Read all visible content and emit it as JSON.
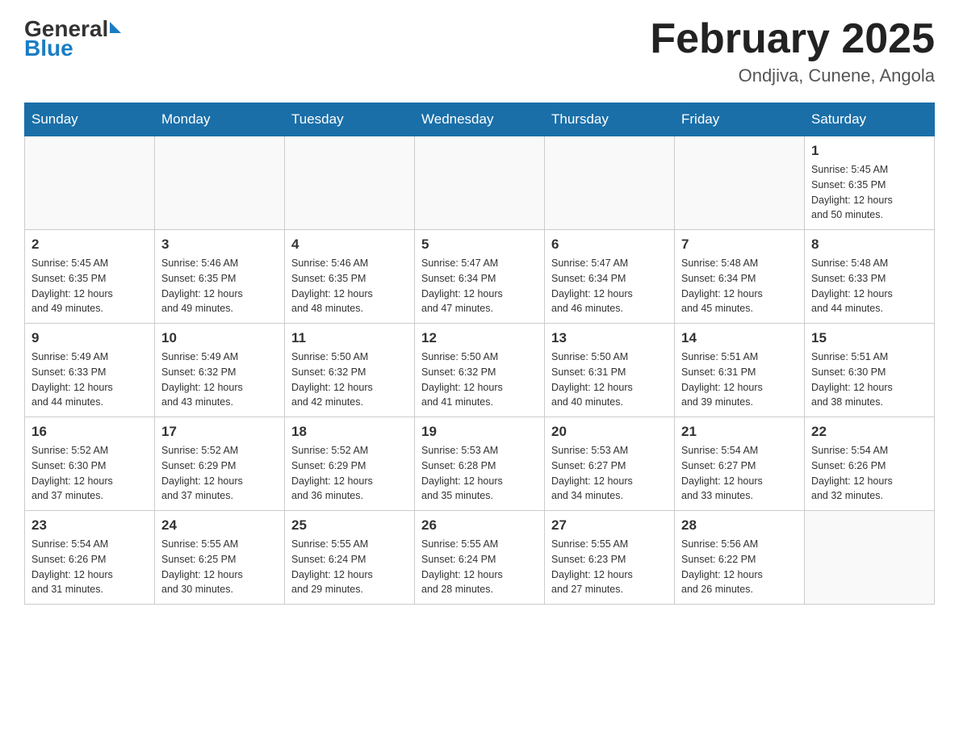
{
  "header": {
    "logo_general": "General",
    "logo_blue": "Blue",
    "title": "February 2025",
    "subtitle": "Ondjiva, Cunene, Angola"
  },
  "days_of_week": [
    "Sunday",
    "Monday",
    "Tuesday",
    "Wednesday",
    "Thursday",
    "Friday",
    "Saturday"
  ],
  "weeks": [
    [
      {
        "day": "",
        "info": ""
      },
      {
        "day": "",
        "info": ""
      },
      {
        "day": "",
        "info": ""
      },
      {
        "day": "",
        "info": ""
      },
      {
        "day": "",
        "info": ""
      },
      {
        "day": "",
        "info": ""
      },
      {
        "day": "1",
        "info": "Sunrise: 5:45 AM\nSunset: 6:35 PM\nDaylight: 12 hours\nand 50 minutes."
      }
    ],
    [
      {
        "day": "2",
        "info": "Sunrise: 5:45 AM\nSunset: 6:35 PM\nDaylight: 12 hours\nand 49 minutes."
      },
      {
        "day": "3",
        "info": "Sunrise: 5:46 AM\nSunset: 6:35 PM\nDaylight: 12 hours\nand 49 minutes."
      },
      {
        "day": "4",
        "info": "Sunrise: 5:46 AM\nSunset: 6:35 PM\nDaylight: 12 hours\nand 48 minutes."
      },
      {
        "day": "5",
        "info": "Sunrise: 5:47 AM\nSunset: 6:34 PM\nDaylight: 12 hours\nand 47 minutes."
      },
      {
        "day": "6",
        "info": "Sunrise: 5:47 AM\nSunset: 6:34 PM\nDaylight: 12 hours\nand 46 minutes."
      },
      {
        "day": "7",
        "info": "Sunrise: 5:48 AM\nSunset: 6:34 PM\nDaylight: 12 hours\nand 45 minutes."
      },
      {
        "day": "8",
        "info": "Sunrise: 5:48 AM\nSunset: 6:33 PM\nDaylight: 12 hours\nand 44 minutes."
      }
    ],
    [
      {
        "day": "9",
        "info": "Sunrise: 5:49 AM\nSunset: 6:33 PM\nDaylight: 12 hours\nand 44 minutes."
      },
      {
        "day": "10",
        "info": "Sunrise: 5:49 AM\nSunset: 6:32 PM\nDaylight: 12 hours\nand 43 minutes."
      },
      {
        "day": "11",
        "info": "Sunrise: 5:50 AM\nSunset: 6:32 PM\nDaylight: 12 hours\nand 42 minutes."
      },
      {
        "day": "12",
        "info": "Sunrise: 5:50 AM\nSunset: 6:32 PM\nDaylight: 12 hours\nand 41 minutes."
      },
      {
        "day": "13",
        "info": "Sunrise: 5:50 AM\nSunset: 6:31 PM\nDaylight: 12 hours\nand 40 minutes."
      },
      {
        "day": "14",
        "info": "Sunrise: 5:51 AM\nSunset: 6:31 PM\nDaylight: 12 hours\nand 39 minutes."
      },
      {
        "day": "15",
        "info": "Sunrise: 5:51 AM\nSunset: 6:30 PM\nDaylight: 12 hours\nand 38 minutes."
      }
    ],
    [
      {
        "day": "16",
        "info": "Sunrise: 5:52 AM\nSunset: 6:30 PM\nDaylight: 12 hours\nand 37 minutes."
      },
      {
        "day": "17",
        "info": "Sunrise: 5:52 AM\nSunset: 6:29 PM\nDaylight: 12 hours\nand 37 minutes."
      },
      {
        "day": "18",
        "info": "Sunrise: 5:52 AM\nSunset: 6:29 PM\nDaylight: 12 hours\nand 36 minutes."
      },
      {
        "day": "19",
        "info": "Sunrise: 5:53 AM\nSunset: 6:28 PM\nDaylight: 12 hours\nand 35 minutes."
      },
      {
        "day": "20",
        "info": "Sunrise: 5:53 AM\nSunset: 6:27 PM\nDaylight: 12 hours\nand 34 minutes."
      },
      {
        "day": "21",
        "info": "Sunrise: 5:54 AM\nSunset: 6:27 PM\nDaylight: 12 hours\nand 33 minutes."
      },
      {
        "day": "22",
        "info": "Sunrise: 5:54 AM\nSunset: 6:26 PM\nDaylight: 12 hours\nand 32 minutes."
      }
    ],
    [
      {
        "day": "23",
        "info": "Sunrise: 5:54 AM\nSunset: 6:26 PM\nDaylight: 12 hours\nand 31 minutes."
      },
      {
        "day": "24",
        "info": "Sunrise: 5:55 AM\nSunset: 6:25 PM\nDaylight: 12 hours\nand 30 minutes."
      },
      {
        "day": "25",
        "info": "Sunrise: 5:55 AM\nSunset: 6:24 PM\nDaylight: 12 hours\nand 29 minutes."
      },
      {
        "day": "26",
        "info": "Sunrise: 5:55 AM\nSunset: 6:24 PM\nDaylight: 12 hours\nand 28 minutes."
      },
      {
        "day": "27",
        "info": "Sunrise: 5:55 AM\nSunset: 6:23 PM\nDaylight: 12 hours\nand 27 minutes."
      },
      {
        "day": "28",
        "info": "Sunrise: 5:56 AM\nSunset: 6:22 PM\nDaylight: 12 hours\nand 26 minutes."
      },
      {
        "day": "",
        "info": ""
      }
    ]
  ]
}
